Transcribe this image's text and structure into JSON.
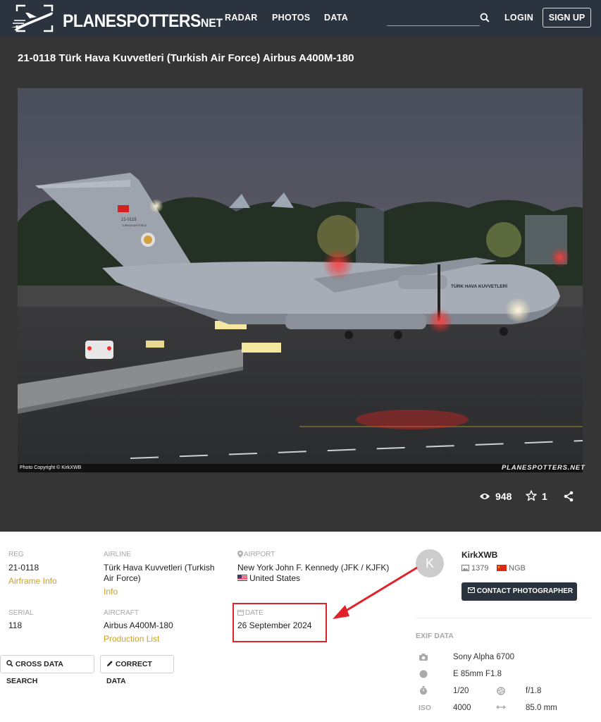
{
  "nav": {
    "logo_main": "PLANESPOTTERS",
    "logo_suffix": "NET",
    "links": [
      "RADAR",
      "PHOTOS",
      "DATA"
    ],
    "search_placeholder": "",
    "login": "LOGIN",
    "signup": "SIGN UP"
  },
  "photo": {
    "title": "21-0118 Türk Hava Kuvvetleri (Turkish Air Force) Airbus A400M-180",
    "copyright": "Photo Copyright © KirkXWB",
    "watermark": "PLANESPOTTERS.NET",
    "tail_text": "21-0118",
    "tail_sub": "TURKISH AIR FORCE",
    "fuselage_text": "TÜRK HAVA KUVVETLERİ",
    "views": "948",
    "favorites": "1"
  },
  "details": {
    "reg_label": "REG",
    "reg": "21-0118",
    "reg_link": "Airframe Info",
    "airline_label": "AIRLINE",
    "airline_line1": "Türk Hava Kuvvetleri (Turkish",
    "airline_line2": "Air Force)",
    "airline_link": "Info",
    "airport_label": "AIRPORT",
    "airport": "New York John F. Kennedy (JFK / KJFK)",
    "country": "United States",
    "serial_label": "SERIAL",
    "serial": "118",
    "aircraft_label": "AIRCRAFT",
    "aircraft": "Airbus A400M-180",
    "aircraft_link": "Production List",
    "date_label": "DATE",
    "date": "26 September 2024",
    "cross_search": "CROSS DATA SEARCH",
    "correct_data": "CORRECT DATA"
  },
  "photographer": {
    "initial": "K",
    "name": "KirkXWB",
    "photo_count": "1379",
    "location": "NGB",
    "contact": "CONTACT PHOTOGRAPHER"
  },
  "exif": {
    "heading": "EXIF DATA",
    "camera": "Sony Alpha 6700",
    "lens": "E 85mm F1.8",
    "shutter": "1/20",
    "aperture": "f/1.8",
    "iso_label": "ISO",
    "iso": "4000",
    "focal": "85.0 mm"
  },
  "colors": {
    "nav_bg": "#2b333e",
    "dark_bg": "#353535",
    "link": "#c9a227",
    "annotation": "#e0232a"
  }
}
